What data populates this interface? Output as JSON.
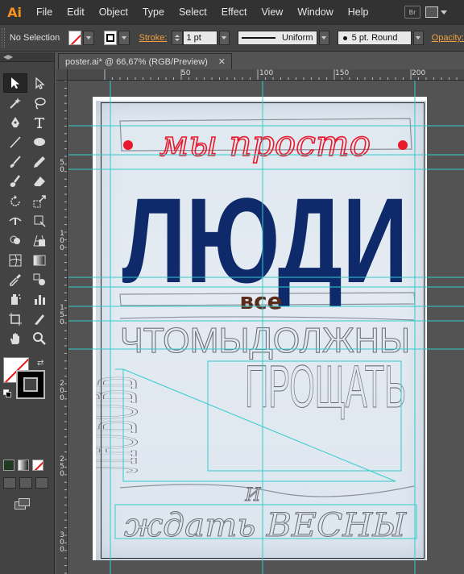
{
  "app": {
    "logo": "Ai",
    "menu": [
      "File",
      "Edit",
      "Object",
      "Type",
      "Select",
      "Effect",
      "View",
      "Window",
      "Help"
    ],
    "bridge_label": "Br",
    "workspace_icon": "workspace-switcher-icon"
  },
  "control_bar": {
    "selection": "No Selection",
    "stroke_label": "Stroke:",
    "stroke_weight": "1 pt",
    "profile": "Uniform",
    "brush": "5 pt. Round",
    "opacity_label": "Opacity:"
  },
  "document": {
    "tab_title": "poster.ai* @ 66,67% (RGB/Preview)",
    "close_glyph": "✕"
  },
  "rulers": {
    "horizontal": [
      "50",
      "100",
      "150",
      "200"
    ],
    "vertical": [
      [
        "5",
        "0"
      ],
      [
        "1",
        "0",
        "0"
      ],
      [
        "1",
        "5",
        "0"
      ],
      [
        "2",
        "0",
        "0"
      ],
      [
        "2",
        "5",
        "0"
      ],
      [
        "3",
        "0",
        "0"
      ]
    ]
  },
  "artwork": {
    "line1": "мы просто",
    "line2": "ЛЮДИ",
    "line3": "все",
    "line4": "ЧТОМЫДОЛЖНЫ",
    "line5a": "ЛЮБОВЬ",
    "line5b": "ПРОЩАТЬ",
    "line6": "И",
    "line7": "ждать  ВЕСНЫ",
    "colors": {
      "red": "#e8192c",
      "navy": "#0f2a6b",
      "brown": "#5a2a1a",
      "pencil": "#6c6f78",
      "guide": "#33cccc"
    }
  },
  "toolbar": {
    "tools": [
      "selection-tool-icon",
      "direct-selection-tool-icon",
      "magic-wand-icon",
      "lasso-icon",
      "pen-tool-icon",
      "type-tool-icon",
      "line-tool-icon",
      "ellipse-tool-icon",
      "paintbrush-icon",
      "pencil-icon",
      "blob-brush-icon",
      "eraser-icon",
      "rotate-icon",
      "scale-icon",
      "width-tool-icon",
      "free-transform-icon",
      "shape-builder-icon",
      "perspective-grid-icon",
      "mesh-icon",
      "gradient-icon",
      "eyedropper-icon",
      "blend-icon",
      "symbol-sprayer-icon",
      "column-graph-icon",
      "artboard-tool-icon",
      "slice-tool-icon",
      "hand-tool-icon",
      "zoom-tool-icon"
    ]
  }
}
